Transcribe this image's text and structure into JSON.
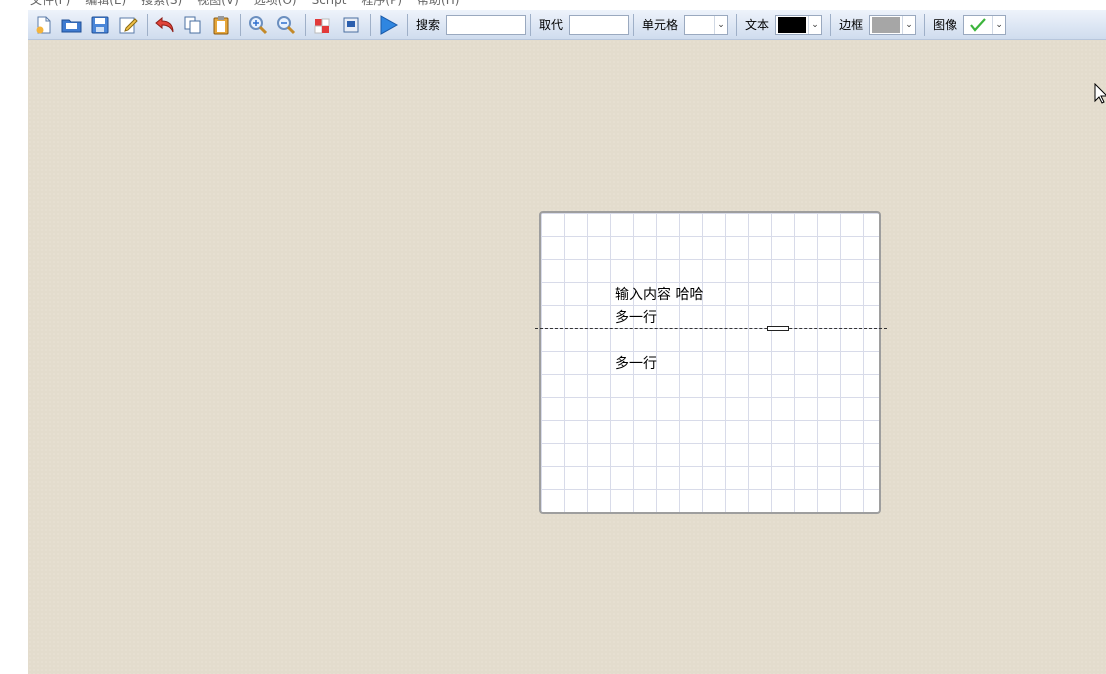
{
  "menubar": {
    "items": [
      "文件(F)",
      "编辑(E)",
      "搜索(S)",
      "视图(V)",
      "选项(O)",
      "Script",
      "程序(P)",
      "帮助(H)"
    ]
  },
  "toolbar": {
    "icons": [
      {
        "name": "new-file-icon"
      },
      {
        "name": "open-folder-icon"
      },
      {
        "name": "save-icon"
      },
      {
        "name": "edit-icon"
      },
      {
        "name": "undo-icon"
      },
      {
        "name": "copy-icon"
      },
      {
        "name": "paste-icon"
      },
      {
        "name": "zoom-in-icon"
      },
      {
        "name": "zoom-out-icon"
      },
      {
        "name": "puzzle-icon"
      },
      {
        "name": "window-icon"
      },
      {
        "name": "play-icon"
      }
    ],
    "search_label": "搜索",
    "search_value": "",
    "replace_label": "取代",
    "replace_value": "",
    "cell_label": "单元格",
    "cell_value": "",
    "text_label": "文本",
    "text_color": "#000000",
    "border_label": "边框",
    "border_color": "#a6a6a6",
    "image_label": "图像",
    "image_check_icon": "checkmark-icon",
    "image_check_color": "#3cb43c"
  },
  "canvas": {
    "background_color": "#e3dccd",
    "card": {
      "line1": "输入内容  哈哈",
      "line2": "多一行",
      "line3": "多一行"
    }
  }
}
